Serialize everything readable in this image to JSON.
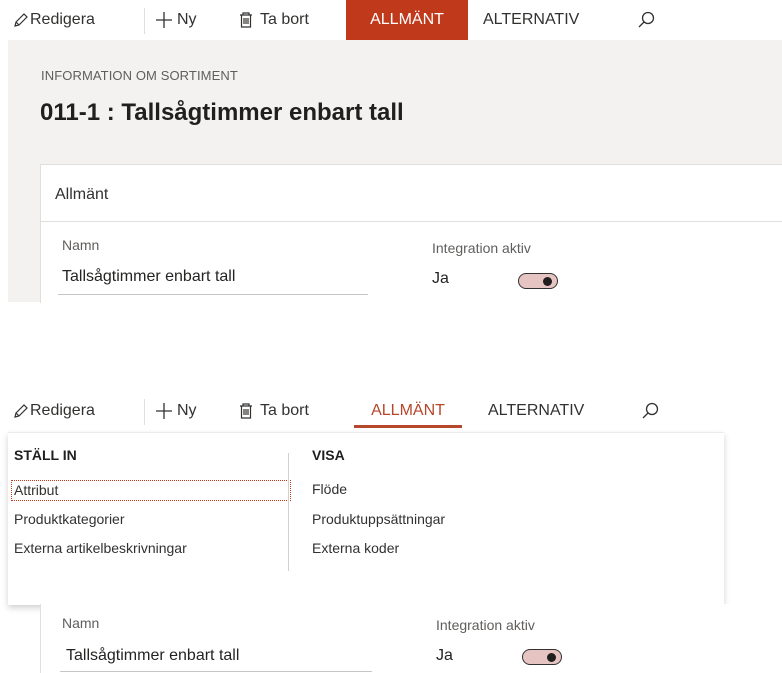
{
  "top": {
    "toolbar": {
      "edit_label": "Redigera",
      "new_label": "Ny",
      "delete_label": "Ta bort",
      "tab_general": "ALLMÄNT",
      "tab_options": "ALTERNATIV",
      "search_icon": "search-icon",
      "active_color": "#c0391b"
    },
    "caption": "INFORMATION OM SORTIMENT",
    "title": "011-1 : Tallsågtimmer enbart tall",
    "card": {
      "header": "Allmänt",
      "name_label": "Namn",
      "name_value": "Tallsågtimmer enbart tall",
      "integration_label": "Integration aktiv",
      "integration_value": "Ja"
    }
  },
  "bottom": {
    "toolbar": {
      "edit_label": "Redigera",
      "new_label": "Ny",
      "delete_label": "Ta bort",
      "tab_general": "ALLMÄNT",
      "tab_options": "ALTERNATIV"
    },
    "menu": {
      "setup_title": "STÄLL IN",
      "setup_items": [
        "Attribut",
        "Produktkategorier",
        "Externa artikelbeskrivningar"
      ],
      "view_title": "VISA",
      "view_items": [
        "Flöde",
        "Produktuppsättningar",
        "Externa koder"
      ]
    },
    "fields": {
      "name_label": "Namn",
      "name_value": "Tallsågtimmer enbart tall",
      "integration_label": "Integration aktiv",
      "integration_value": "Ja"
    }
  }
}
